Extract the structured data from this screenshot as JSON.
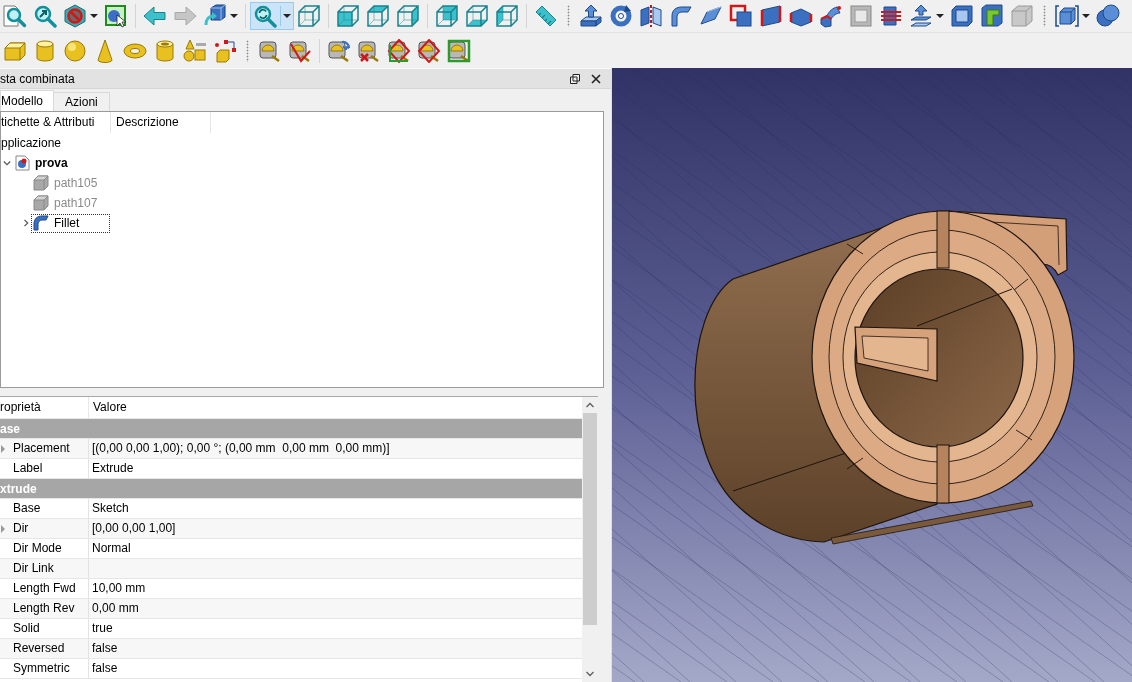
{
  "toolbar_rows": [
    {
      "toolbars": [
        {
          "groups": [
            [
              {
                "kind": "magnifier-page",
                "dropdown": false,
                "pressed": false,
                "disabled": false
              },
              {
                "kind": "magnifier-arrow",
                "dropdown": false,
                "pressed": false,
                "disabled": false
              },
              {
                "kind": "no-entry",
                "dropdown": true,
                "pressed": false,
                "disabled": false
              },
              {
                "kind": "cube-cursor",
                "dropdown": false,
                "pressed": false,
                "disabled": false
              }
            ],
            [
              {
                "kind": "left-arrow",
                "dropdown": false,
                "pressed": false,
                "disabled": false
              },
              {
                "kind": "right-arrow",
                "dropdown": false,
                "pressed": false,
                "disabled": true
              },
              {
                "kind": "cube-curved-arrow",
                "dropdown": true,
                "pressed": false,
                "disabled": false
              }
            ],
            [
              {
                "kind": "magnifier-refresh",
                "dropdown": true,
                "pressed": true,
                "disabled": false
              },
              {
                "kind": "wireframe-cube",
                "dropdown": false,
                "pressed": false,
                "disabled": false
              }
            ],
            [
              {
                "kind": "cube-front",
                "dropdown": false,
                "pressed": false,
                "disabled": false
              },
              {
                "kind": "cube-top",
                "dropdown": false,
                "pressed": false,
                "disabled": false
              },
              {
                "kind": "cube-right",
                "dropdown": false,
                "pressed": false,
                "disabled": false
              }
            ],
            [
              {
                "kind": "cube-rear",
                "dropdown": false,
                "pressed": false,
                "disabled": false
              },
              {
                "kind": "cube-bottom",
                "dropdown": false,
                "pressed": false,
                "disabled": false
              },
              {
                "kind": "cube-left",
                "dropdown": false,
                "pressed": false,
                "disabled": false
              }
            ],
            [
              {
                "kind": "ruler",
                "dropdown": false,
                "pressed": false,
                "disabled": false
              }
            ]
          ]
        },
        {
          "groups": [
            [
              {
                "kind": "box-up-arrow",
                "dropdown": false,
                "pressed": false,
                "disabled": false
              },
              {
                "kind": "circular-arrow",
                "dropdown": false,
                "pressed": false,
                "disabled": false
              },
              {
                "kind": "mirrored-panels",
                "dropdown": false,
                "pressed": false,
                "disabled": false
              },
              {
                "kind": "curved-sheet",
                "dropdown": false,
                "pressed": false,
                "disabled": false
              },
              {
                "kind": "bevel-sheet",
                "dropdown": false,
                "pressed": false,
                "disabled": false
              },
              {
                "kind": "outlined-squares",
                "dropdown": false,
                "pressed": false,
                "disabled": false
              },
              {
                "kind": "ruled-panel",
                "dropdown": false,
                "pressed": false,
                "disabled": false
              },
              {
                "kind": "hexagon-block",
                "dropdown": false,
                "pressed": false,
                "disabled": false
              },
              {
                "kind": "bent-tube",
                "dropdown": false,
                "pressed": false,
                "disabled": false
              },
              {
                "kind": "square-frame",
                "dropdown": false,
                "pressed": false,
                "disabled": false
              },
              {
                "kind": "sliced-block",
                "dropdown": false,
                "pressed": false,
                "disabled": false
              },
              {
                "kind": "layers-up-arrow",
                "dropdown": true,
                "pressed": false,
                "disabled": false
              },
              {
                "kind": "hollow-box",
                "dropdown": false,
                "pressed": false,
                "disabled": false
              },
              {
                "kind": "step-block",
                "dropdown": false,
                "pressed": false,
                "disabled": false
              },
              {
                "kind": "cube",
                "dropdown": false,
                "pressed": false,
                "disabled": false
              }
            ]
          ]
        },
        {
          "groups": [
            [
              {
                "kind": "bracketed-cube",
                "dropdown": true,
                "pressed": false,
                "disabled": false
              },
              {
                "kind": "two-spheres",
                "dropdown": false,
                "pressed": false,
                "disabled": false
              }
            ]
          ]
        }
      ]
    },
    {
      "toolbars": [
        {
          "groups": [
            [
              {
                "kind": "box",
                "dropdown": false,
                "pressed": false,
                "disabled": false
              },
              {
                "kind": "cylinder",
                "dropdown": false,
                "pressed": false,
                "disabled": false
              },
              {
                "kind": "sphere",
                "dropdown": false,
                "pressed": false,
                "disabled": false
              },
              {
                "kind": "cone",
                "dropdown": false,
                "pressed": false,
                "disabled": false
              },
              {
                "kind": "torus",
                "dropdown": false,
                "pressed": false,
                "disabled": false
              },
              {
                "kind": "tube",
                "dropdown": false,
                "pressed": false,
                "disabled": false
              },
              {
                "kind": "primitive-shapes",
                "dropdown": false,
                "pressed": false,
                "disabled": false
              },
              {
                "kind": "cube-nodes",
                "dropdown": false,
                "pressed": false,
                "disabled": false
              }
            ]
          ]
        },
        {
          "groups": [
            [
              {
                "kind": "tape-measure",
                "dropdown": false,
                "pressed": false,
                "disabled": false
              },
              {
                "kind": "tape-measure-angle",
                "dropdown": false,
                "pressed": false,
                "disabled": false
              }
            ],
            [
              {
                "kind": "tape-measure-swirl",
                "dropdown": false,
                "pressed": false,
                "disabled": false
              },
              {
                "kind": "tape-measure-cross",
                "dropdown": false,
                "pressed": false,
                "disabled": false
              },
              {
                "kind": "tape-measure-diamond-frame",
                "dropdown": false,
                "pressed": false,
                "disabled": false
              },
              {
                "kind": "tape-measure-diamond",
                "dropdown": false,
                "pressed": false,
                "disabled": false
              },
              {
                "kind": "tape-measure-frame",
                "dropdown": false,
                "pressed": false,
                "disabled": false
              }
            ]
          ]
        }
      ]
    }
  ],
  "combo_view": {
    "title": "sta combinata",
    "tabs": [
      {
        "label": "Modello",
        "selected": true
      },
      {
        "label": "Azioni",
        "selected": false
      }
    ],
    "tree": {
      "columns": [
        "tichette & Attributi",
        "Descrizione"
      ],
      "root": {
        "label": "pplicazione",
        "children": [
          {
            "label": "prova",
            "kind": "document",
            "expanded": true,
            "hidden": false,
            "current": false,
            "children": [
              {
                "label": "path105",
                "kind": "shape",
                "hidden": true,
                "current": false
              },
              {
                "label": "path107",
                "kind": "shape",
                "hidden": true,
                "current": false
              },
              {
                "label": "Fillet",
                "kind": "fillet",
                "expanded": false,
                "hidden": false,
                "current": true
              }
            ]
          }
        ]
      }
    }
  },
  "properties": {
    "columns": [
      "roprietà",
      "Valore"
    ],
    "rows": [
      {
        "kind": "group",
        "label": "ase"
      },
      {
        "kind": "property",
        "name": "Placement",
        "value": "[(0,00 0,00 1,00); 0,00 °; (0,00 mm  0,00 mm  0,00 mm)]",
        "expanded": false
      },
      {
        "kind": "property",
        "name": "Label",
        "value": "Extrude"
      },
      {
        "kind": "group",
        "label": "xtrude"
      },
      {
        "kind": "property",
        "name": "Base",
        "value": "Sketch"
      },
      {
        "kind": "property",
        "name": "Dir",
        "value": "[0,00 0,00 1,00]",
        "expanded": false
      },
      {
        "kind": "property",
        "name": "Dir Mode",
        "value": "Normal"
      },
      {
        "kind": "property",
        "name": "Dir Link"
      },
      {
        "kind": "property",
        "name": "Length Fwd",
        "value": "10,00 mm"
      },
      {
        "kind": "property",
        "name": "Length Rev",
        "value": "0,00 mm"
      },
      {
        "kind": "property",
        "name": "Solid",
        "value": "true"
      },
      {
        "kind": "property",
        "name": "Reversed",
        "value": "false"
      },
      {
        "kind": "property",
        "name": "Symmetric",
        "value": "false"
      }
    ]
  }
}
